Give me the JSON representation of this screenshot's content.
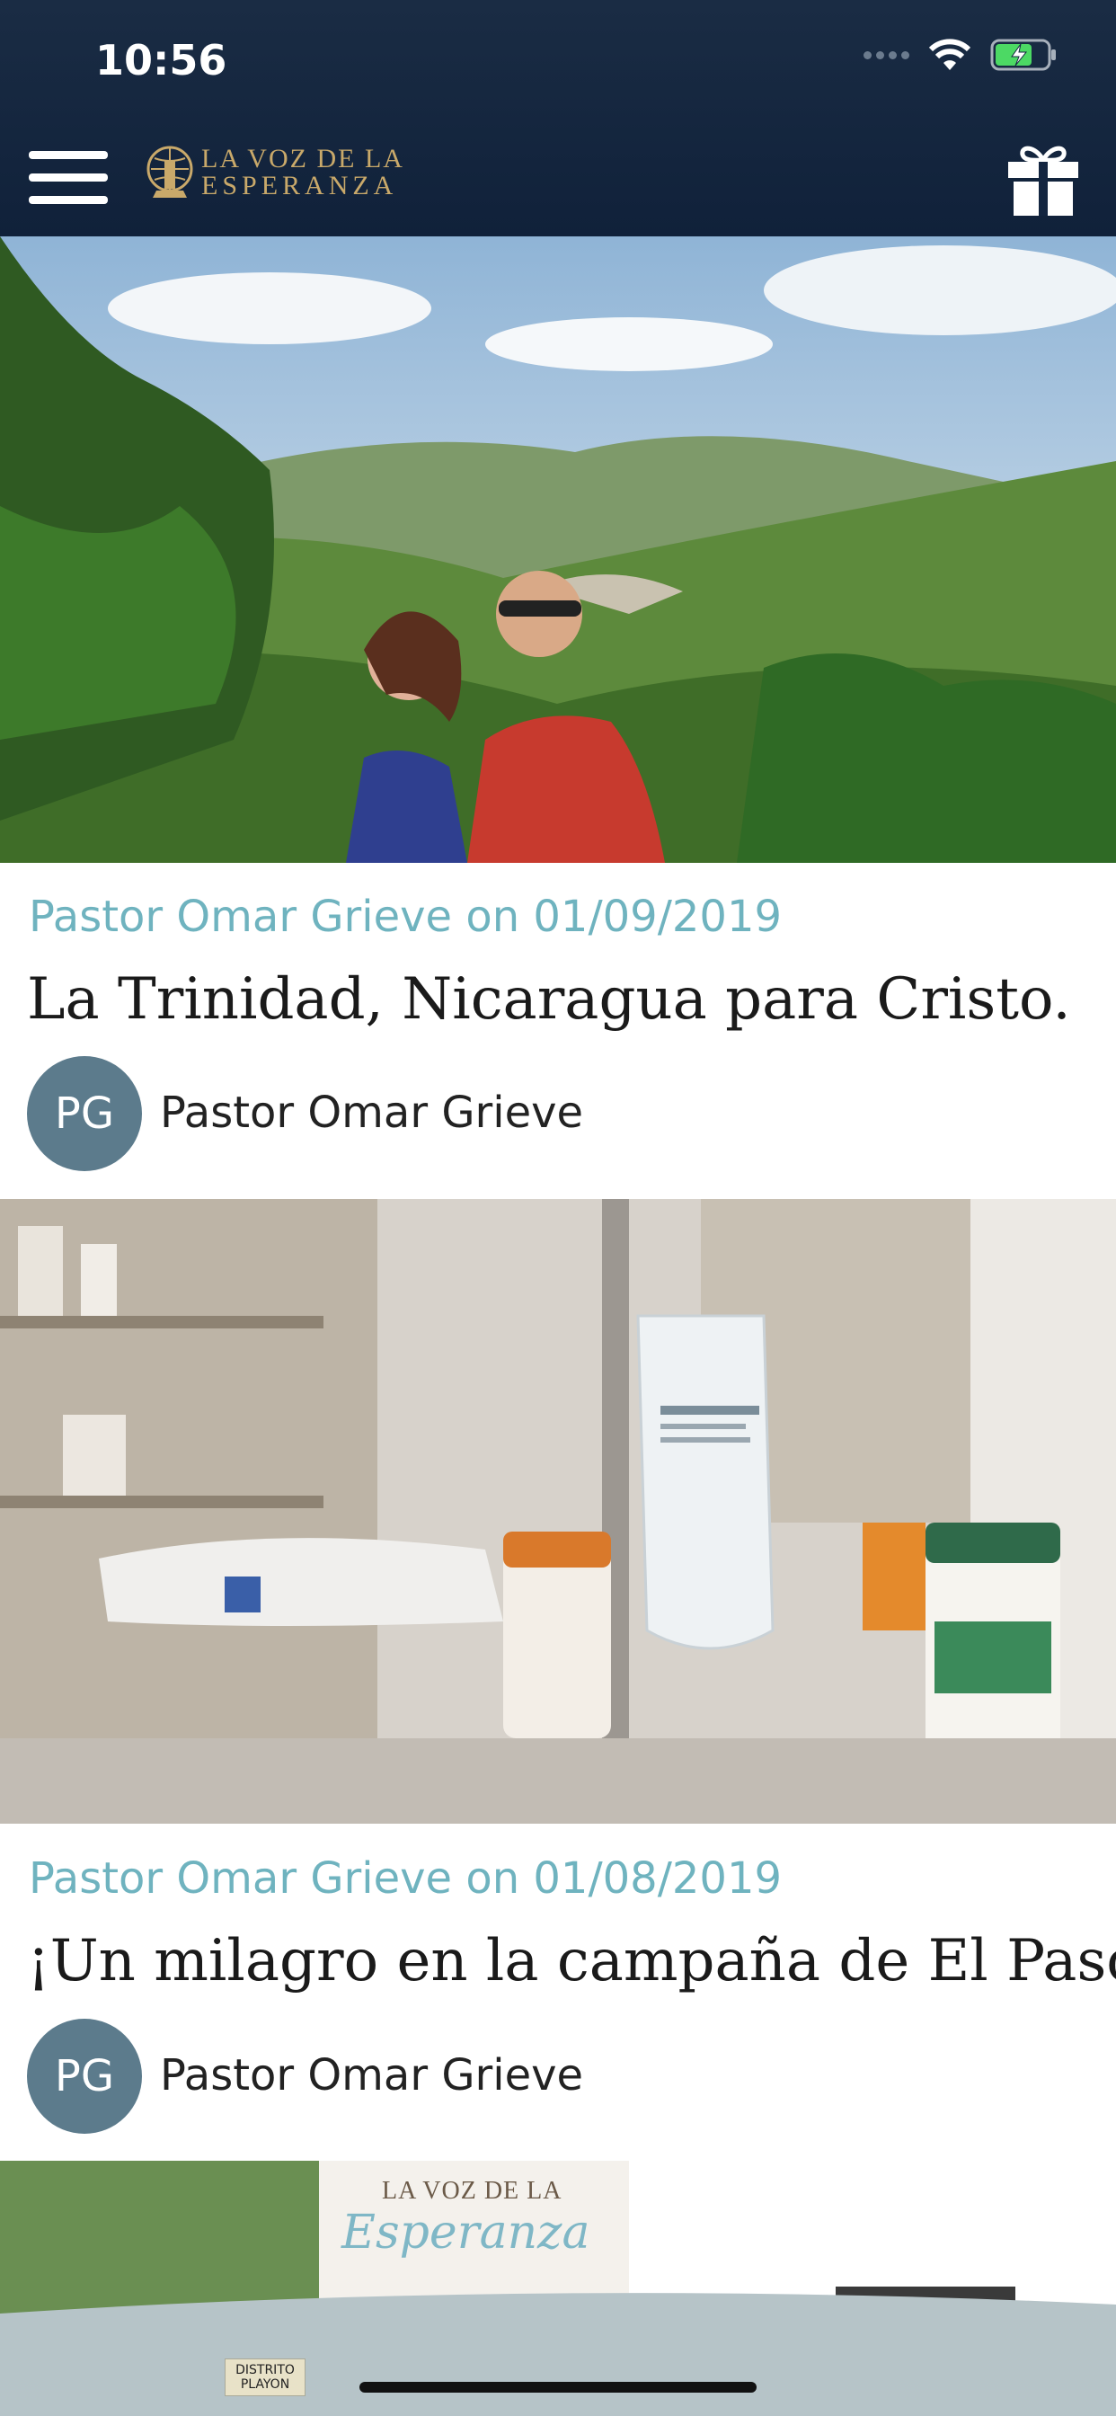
{
  "status": {
    "time": "10:56"
  },
  "header": {
    "logo_line1": "LA VOZ DE LA",
    "logo_line2": "ESPERANZA"
  },
  "posts": [
    {
      "meta": "Pastor Omar Grieve on 01/09/2019",
      "title": "La Trinidad, Nicaragua para Cristo.",
      "author_initials": "PG",
      "author_name": "Pastor Omar Grieve"
    },
    {
      "meta": "Pastor Omar Grieve on 01/08/2019",
      "title": "¡Un milagro en la campaña de El Paso!",
      "author_initials": "PG",
      "author_name": "Pastor Omar Grieve"
    }
  ],
  "third_banner": {
    "line1": "LA VOZ DE LA",
    "line2": "Esperanza",
    "sign": "DISTRITO PLAYON"
  },
  "colors": {
    "header": "#132540",
    "meta": "#6fb3bf",
    "avatar": "#5c7b8c",
    "gold": "#c9a96a"
  }
}
